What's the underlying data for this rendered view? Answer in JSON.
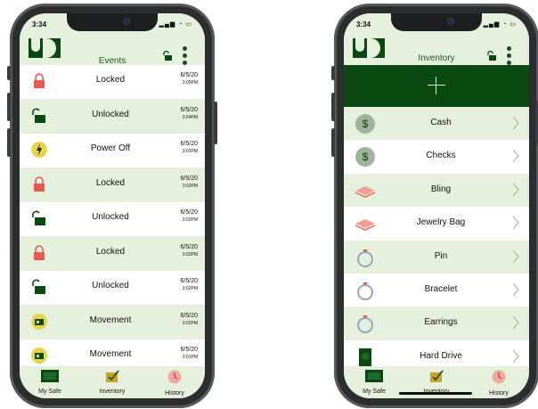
{
  "left_phone": {
    "status": {
      "time": "3:34",
      "icons": "▂▄▆ ◔ ▭"
    },
    "header": {
      "title": "Events"
    },
    "events": [
      {
        "label": "Locked",
        "date": "6/5/20",
        "time": "3:05PM",
        "icon": "padlock-closed-red-icon"
      },
      {
        "label": "Unlocked",
        "date": "6/5/20",
        "time": "3:04PM",
        "icon": "padlock-open-green-icon"
      },
      {
        "label": "Power Off",
        "date": "6/5/20",
        "time": "3:02PM",
        "icon": "power-bolt-icon"
      },
      {
        "label": "Locked",
        "date": "6/5/20",
        "time": "3:02PM",
        "icon": "padlock-closed-red-icon"
      },
      {
        "label": "Unlocked",
        "date": "6/5/20",
        "time": "3:02PM",
        "icon": "padlock-open-green-icon"
      },
      {
        "label": "Locked",
        "date": "6/5/20",
        "time": "3:02PM",
        "icon": "padlock-closed-red-icon"
      },
      {
        "label": "Unlocked",
        "date": "6/5/20",
        "time": "3:02PM",
        "icon": "padlock-open-green-icon"
      },
      {
        "label": "Movement",
        "date": "6/5/20",
        "time": "3:02PM",
        "icon": "movement-icon"
      },
      {
        "label": "Movement",
        "date": "6/5/20",
        "time": "3:01PM",
        "icon": "movement-icon"
      }
    ],
    "tabs": [
      {
        "label": "My Safe",
        "icon": "safe-icon"
      },
      {
        "label": "Inventory",
        "icon": "inventory-box-icon"
      },
      {
        "label": "History",
        "icon": "clock-icon"
      }
    ]
  },
  "right_phone": {
    "status": {
      "time": "3:34",
      "icons": "▂▄▆ ◔ ▭"
    },
    "header": {
      "title": "Inventory"
    },
    "items": [
      {
        "label": "Cash",
        "icon": "dollar-coin-icon"
      },
      {
        "label": "Checks",
        "icon": "dollar-coin-icon"
      },
      {
        "label": "Bling",
        "icon": "gem-stack-icon"
      },
      {
        "label": "Jewelry Bag",
        "icon": "gem-stack-icon"
      },
      {
        "label": "Pin",
        "icon": "ring-icon"
      },
      {
        "label": "Bracelet",
        "icon": "ring-icon"
      },
      {
        "label": "Earrings",
        "icon": "ring-icon"
      },
      {
        "label": "Hard Drive",
        "icon": "hard-drive-icon"
      }
    ],
    "tabs": [
      {
        "label": "My Safe",
        "icon": "safe-icon"
      },
      {
        "label": "Inventory",
        "icon": "inventory-box-icon"
      },
      {
        "label": "History",
        "icon": "clock-icon"
      }
    ]
  },
  "colors": {
    "brand_green": "#0a4a12",
    "light_green": "#e5f1dd",
    "lock_red": "#e85a4f",
    "history_pink": "#f0a8a0",
    "inventory_gold": "#c9a227"
  }
}
